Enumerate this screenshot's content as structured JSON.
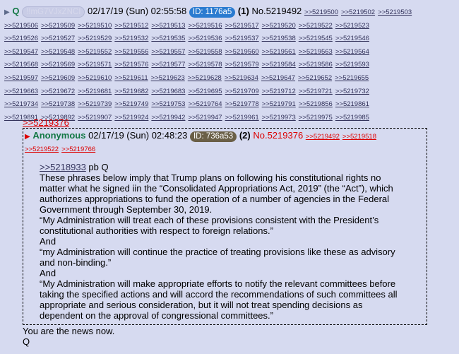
{
  "post": {
    "name": "Q",
    "tripcode": "!!mG7VJxZNCI",
    "datetime": "02/17/19 (Sun) 02:55:58",
    "id_label": "ID: 1176a5",
    "count": "(1)",
    "number": "No.5219492",
    "backlink_rows": [
      [
        ">>5219500",
        ">>5219502",
        ">>5219503"
      ],
      [
        ">>5219506",
        ">>5219509",
        ">>5219510",
        ">>5219512",
        ">>5219513",
        ">>5219516",
        ">>5219517",
        ">>5219520",
        ">>5219522",
        ">>5219523"
      ],
      [
        ">>5219526",
        ">>5219527",
        ">>5219529",
        ">>5219532",
        ">>5219535",
        ">>5219536",
        ">>5219537",
        ">>5219538",
        ">>5219545",
        ">>5219546"
      ],
      [
        ">>5219547",
        ">>5219548",
        ">>5219552",
        ">>5219556",
        ">>5219557",
        ">>5219558",
        ">>5219560",
        ">>5219561",
        ">>5219563",
        ">>5219564"
      ],
      [
        ">>5219568",
        ">>5219569",
        ">>5219571",
        ">>5219576",
        ">>5219577",
        ">>5219578",
        ">>5219579",
        ">>5219584",
        ">>5219586",
        ">>5219593"
      ],
      [
        ">>5219597",
        ">>5219609",
        ">>5219610",
        ">>5219611",
        ">>5219623",
        ">>5219628",
        ">>5219634",
        ">>5219647",
        ">>5219652",
        ">>5219655"
      ],
      [
        ">>5219663",
        ">>5219672",
        ">>5219681",
        ">>5219682",
        ">>5219683",
        ">>5219695",
        ">>5219709",
        ">>5219712",
        ">>5219721",
        ">>5219732"
      ],
      [
        ">>5219734",
        ">>5219738",
        ">>5219739",
        ">>5219749",
        ">>5219753",
        ">>5219764",
        ">>5219778",
        ">>5219791",
        ">>5219856",
        ">>5219861"
      ],
      [
        ">>5219891",
        ">>5219892",
        ">>5219907",
        ">>5219924",
        ">>5219942",
        ">>5219947",
        ">>5219961",
        ">>5219973",
        ">>5219975",
        ">>5219985"
      ]
    ],
    "quote_link": ">>5219376",
    "quoted": {
      "name": "Anonymous",
      "datetime": "02/17/19 (Sun) 02:48:23",
      "id_label": "ID: 736a53",
      "count": "(2)",
      "number": "No.5219376",
      "backlinks": [
        ">>5219492",
        ">>5219518",
        ">>5219522",
        ">>5219766"
      ],
      "ref_link": ">>5218933",
      "ref_suffix": " pb Q",
      "lines": [
        "These phrases below imply that Trump plans on following his constitutional rights no matter what he signed iin the “Consolidated Appropriations Act, 2019” (the “Act”), which authorizes appropriations to fund the operation of a number of agencies in the Federal Government through September 30, 2019.",
        "“My Administration will treat each of these provisions consistent with the President’s constitutional authorities with respect to foreign relations.”",
        "And",
        "“my Administration will continue the practice of treating provisions like these as advisory and non-binding.”",
        "And",
        "“My Administration will make appropriate efforts to notify the relevant committees before taking the specified actions and will accord the recommendations of such committees all appropriate and serious consideration, but it will not treat spending decisions as dependent on the approval of congressional committees.”"
      ]
    },
    "footer_lines": [
      "You are the news now.",
      "Q"
    ]
  }
}
